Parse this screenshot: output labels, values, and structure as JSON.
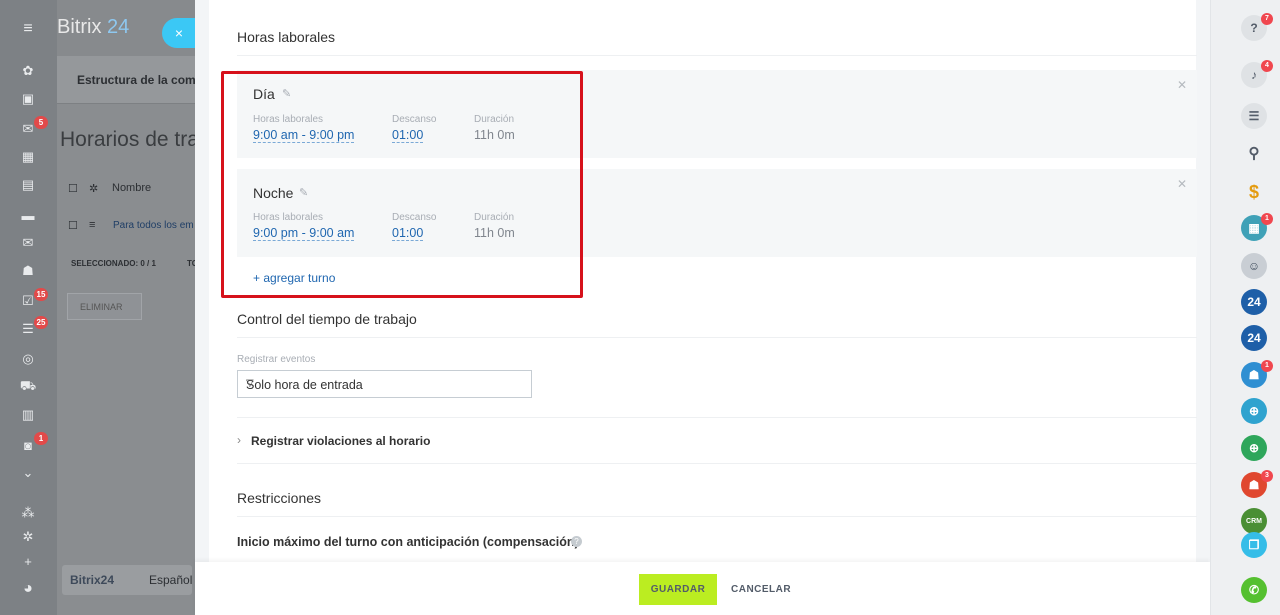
{
  "background": {
    "brand_text": "Bitrix",
    "brand_num": "24",
    "card_title": "Estructura de la com",
    "page_title": "Horarios de tra",
    "col_name": "Nombre",
    "row_text": "Para todos los em",
    "selected": "SELECCIONADO: 0 / 1",
    "selected_extra": "TO",
    "delete_btn": "ELIMINAR",
    "footer_brand": "Bitrix24",
    "footer_lang": "Español",
    "left_badges": [
      "5",
      "15",
      "25",
      "1"
    ]
  },
  "slider": {
    "close_icon": "×",
    "work_hours_title": "Horas laborales",
    "shifts": [
      {
        "name": "Día",
        "hours_label": "Horas laborales",
        "hours": "9:00 am - 9:00 pm",
        "break_label": "Descanso",
        "break": "01:00",
        "duration_label": "Duración",
        "duration": "11h 0m"
      },
      {
        "name": "Noche",
        "hours_label": "Horas laborales",
        "hours": "9:00 pm - 9:00 am",
        "break_label": "Descanso",
        "break": "01:00",
        "duration_label": "Duración",
        "duration": "11h 0m"
      }
    ],
    "add_shift": "+ agregar turno",
    "time_control_title": "Control del tiempo de trabajo",
    "register_events_label": "Registrar eventos",
    "register_events_value": "Solo hora de entrada",
    "violations_label": "Registrar violaciones al horario",
    "restrictions_title": "Restricciones",
    "max_start_label": "Inicio máximo del turno con anticipación (compensación)",
    "save_button": "GUARDAR",
    "cancel_button": "CANCELAR"
  },
  "rightbar": {
    "badges": [
      "7",
      "4",
      "1",
      "1",
      "3"
    ],
    "b24_label": "24",
    "crm_label": "CRM"
  },
  "colors": {
    "accent_blue": "#2067b0",
    "save_green": "#bbed21",
    "highlight_red": "#d6111b",
    "close_cyan": "#3bc8f5"
  }
}
